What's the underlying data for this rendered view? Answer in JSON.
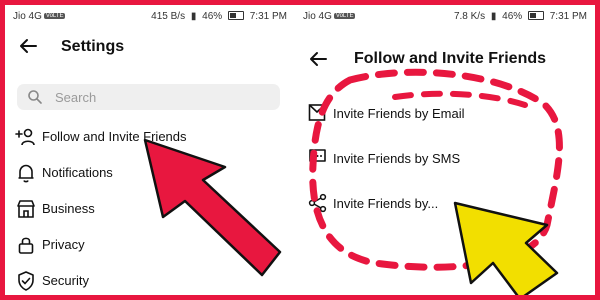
{
  "left": {
    "status": {
      "carrier": "Jio 4G",
      "volte": "VoLTE",
      "speed": "415 B/s",
      "battery": "46%",
      "time": "7:31 PM"
    },
    "title": "Settings",
    "search": {
      "placeholder": "Search"
    },
    "items": [
      {
        "label": "Follow and Invite Friends",
        "icon": "add-person-icon"
      },
      {
        "label": "Notifications",
        "icon": "bell-icon"
      },
      {
        "label": "Business",
        "icon": "storefront-icon"
      },
      {
        "label": "Privacy",
        "icon": "lock-icon"
      },
      {
        "label": "Security",
        "icon": "shield-icon"
      }
    ]
  },
  "right": {
    "status": {
      "carrier": "Jio 4G",
      "volte": "VoLTE",
      "speed": "7.8 K/s",
      "battery": "46%",
      "time": "7:31 PM"
    },
    "title": "Follow and Invite Friends",
    "items": [
      {
        "label": "Invite Friends by Email",
        "icon": "envelope-icon"
      },
      {
        "label": "Invite Friends by SMS",
        "icon": "chat-bubble-icon"
      },
      {
        "label": "Invite Friends by...",
        "icon": "share-icon"
      }
    ]
  },
  "colors": {
    "border": "#e8173f",
    "arrow_left": "#e8173f",
    "arrow_right": "#f2df00",
    "dash": "#e8173f"
  }
}
